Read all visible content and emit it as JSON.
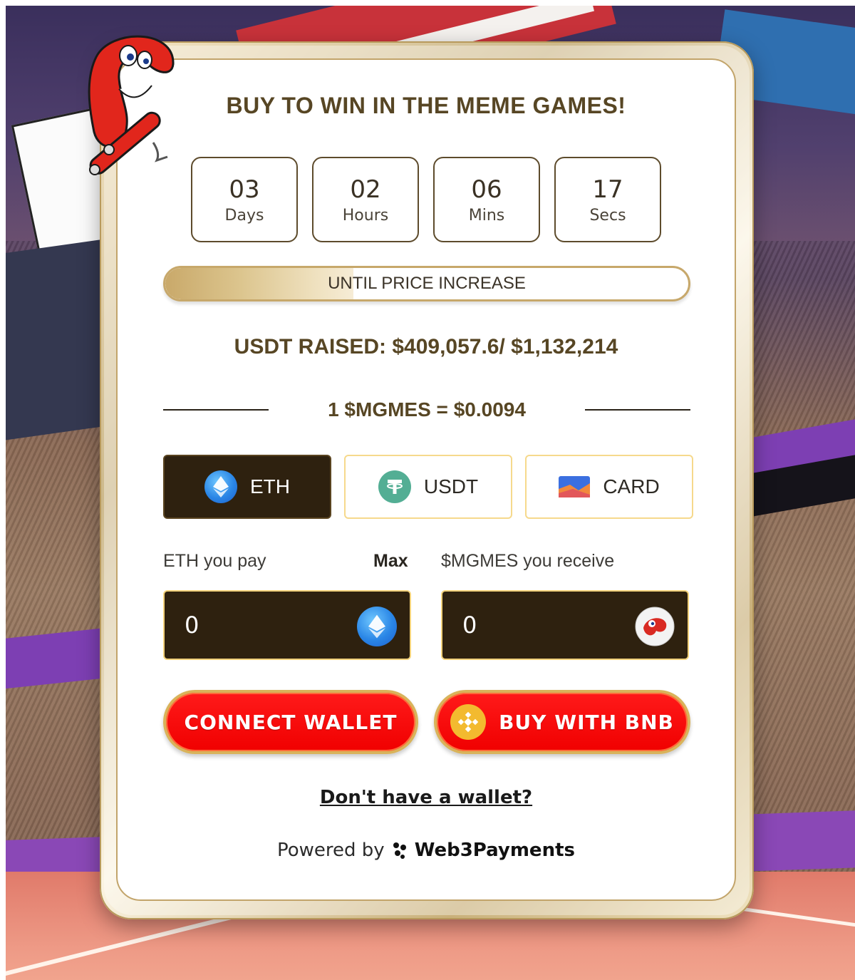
{
  "widget": {
    "title": "BUY TO WIN IN THE MEME GAMES!",
    "countdown": [
      {
        "value": "03",
        "label": "Days"
      },
      {
        "value": "02",
        "label": "Hours"
      },
      {
        "value": "06",
        "label": "Mins"
      },
      {
        "value": "17",
        "label": "Secs"
      }
    ],
    "progress": {
      "label": "UNTIL PRICE INCREASE",
      "fraction": 0.36
    },
    "raised_text": "USDT RAISED: $409,057.6/ $1,132,214",
    "price_text": "1 $MGMES = $0.0094",
    "payment_tabs": [
      {
        "label": "ETH",
        "icon": "eth-icon",
        "active": true
      },
      {
        "label": "USDT",
        "icon": "usdt-icon",
        "active": false
      },
      {
        "label": "CARD",
        "icon": "card-icon",
        "active": false
      }
    ],
    "pay": {
      "label": "ETH you pay",
      "max_label": "Max",
      "value": "0",
      "icon": "eth-icon"
    },
    "receive": {
      "label": "$MGMES you receive",
      "value": "0",
      "icon": "mgmes-token-icon"
    },
    "buttons": {
      "connect": "CONNECT WALLET",
      "buy_bnb": "BUY WITH BNB"
    },
    "no_wallet_link": "Don't have a wallet?",
    "powered_by": {
      "prefix": "Powered by",
      "brand": "Web3Payments"
    }
  },
  "colors": {
    "accent_text": "#574624",
    "dark_brown": "#2e210f",
    "gold_border": "#c7a86b",
    "button_red": "#f00000",
    "bnb_yellow": "#f3ba2f"
  }
}
